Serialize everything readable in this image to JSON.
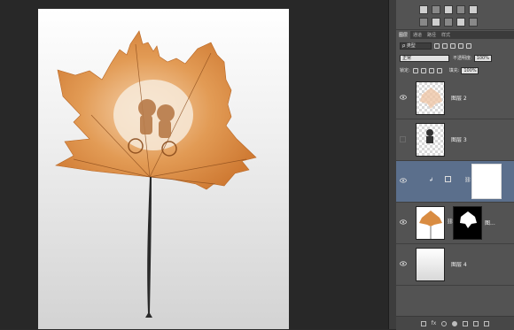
{
  "canvas": {
    "artwork": "leaf-carving-image"
  },
  "tools_panel": {
    "row1_icons": [
      "layer-style-icon",
      "group-icon",
      "mask-icon",
      "adjust-icon",
      "link-icon"
    ],
    "row2_icons": [
      "new-icon",
      "fx-icon",
      "eye-icon",
      "lock-icon",
      "trash-icon"
    ]
  },
  "layers_panel": {
    "tabs": [
      "图层",
      "通道",
      "路径",
      "样式"
    ],
    "filter_label": "ρ 类型",
    "blend_mode": "正常",
    "opacity_label": "不透明度:",
    "opacity_value": "100%",
    "lock_label": "锁定:",
    "fill_label": "填充:",
    "fill_value": "100%",
    "layers": [
      {
        "name": "图层 2",
        "visible": true
      },
      {
        "name": "图层 3",
        "visible": false
      },
      {
        "name": "",
        "visible": true,
        "selected": true
      },
      {
        "name": "图...",
        "visible": true
      },
      {
        "name": "图层 4",
        "visible": true
      }
    ],
    "footer_icons": [
      "link-icon",
      "fx-icon",
      "mask-icon",
      "adjustment-icon",
      "folder-icon",
      "new-layer-icon",
      "trash-icon"
    ]
  },
  "colors": {
    "panel_bg": "#535353",
    "selected_layer": "#5b6f8c",
    "leaf": "#d58b46",
    "workspace_bg": "#282828"
  }
}
